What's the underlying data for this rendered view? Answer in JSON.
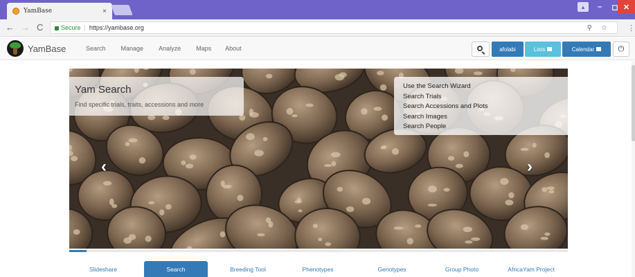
{
  "browser": {
    "tab_title": "YamBase",
    "tab_close": "×",
    "secure_label": "Secure",
    "url": "https://yambase.org",
    "window_user_label": "▲",
    "minimize": "–",
    "maximize": "◻",
    "close": "✕",
    "back": "←",
    "forward": "→",
    "reload": "C",
    "key": "⚲",
    "star": "☆",
    "menu": "⋮"
  },
  "navbar": {
    "brand": "YamBase",
    "links": [
      "Search",
      "Manage",
      "Analyze",
      "Maps",
      "About"
    ],
    "user": "afolabi",
    "lists": "Lists",
    "calendar": "Calendar",
    "logout": "⏻"
  },
  "carousel": {
    "title": "Yam Search",
    "subtitle": "Find specific trials, traits, accessions and more",
    "links": [
      "Use the Search Wizard",
      "Search Trials",
      "Search Accessions and Plots",
      "Search Images",
      "Search People"
    ],
    "prev": "‹",
    "next": "›",
    "progress": 0.035
  },
  "bottom_tabs": [
    {
      "label": "Slideshare",
      "active": false
    },
    {
      "label": "Search",
      "active": true
    },
    {
      "label": "Breeding Tool",
      "active": false
    },
    {
      "label": "Phenotypes",
      "active": false
    },
    {
      "label": "Genotypes",
      "active": false
    },
    {
      "label": "Group Photo",
      "active": false
    },
    {
      "label": "AfricaYam Project",
      "active": false
    }
  ],
  "colors": {
    "browser_frame": "#6f63c9",
    "primary": "#337ab7",
    "info": "#5bc0de",
    "close_button": "#e4433a"
  }
}
